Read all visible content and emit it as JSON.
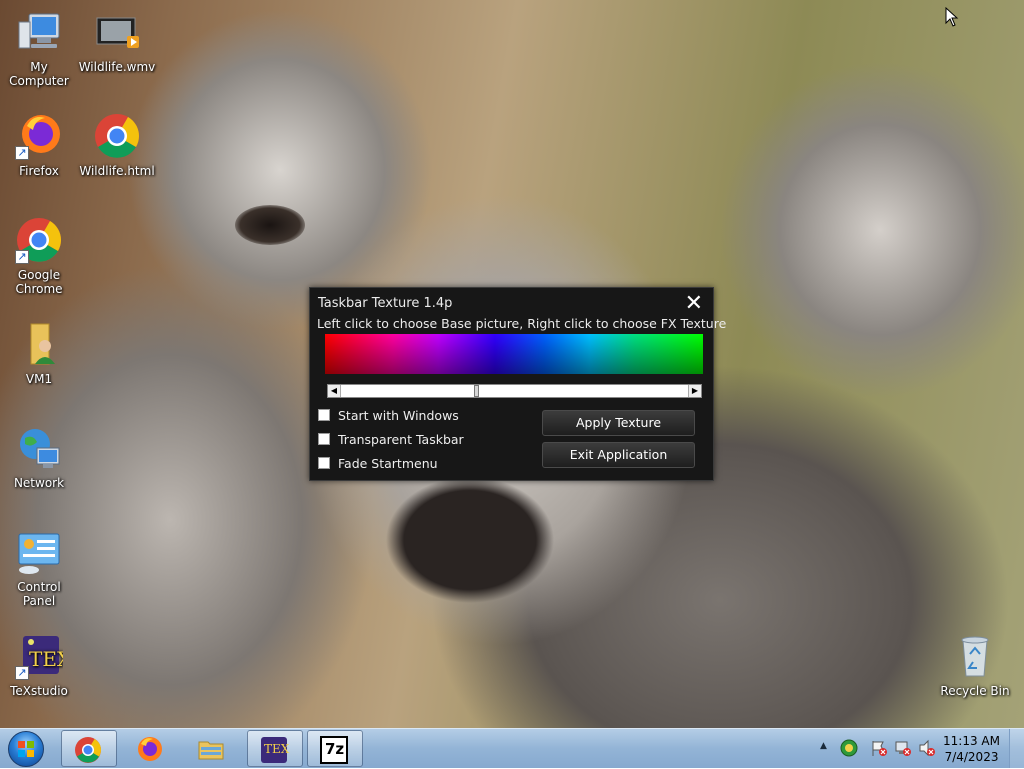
{
  "desktop": {
    "icons": [
      {
        "label": "My Computer",
        "icon": "computer-icon"
      },
      {
        "label": "Wildlife.wmv",
        "icon": "video-file-icon"
      },
      {
        "label": "Firefox",
        "icon": "firefox-icon"
      },
      {
        "label": "Wildlife.html",
        "icon": "chrome-icon"
      },
      {
        "label": "Google Chrome",
        "icon": "chrome-icon"
      },
      {
        "label": "VM1",
        "icon": "user-folder-icon"
      },
      {
        "label": "Network",
        "icon": "network-icon"
      },
      {
        "label": "Control Panel",
        "icon": "control-panel-icon"
      },
      {
        "label": "TeXstudio",
        "icon": "texstudio-icon"
      },
      {
        "label": "Recycle Bin",
        "icon": "recycle-bin-icon"
      }
    ]
  },
  "dialog": {
    "title": "Taskbar Texture 1.4p",
    "close_glyph": "✕",
    "instruction": "Left click to choose Base picture, Right click to choose FX Texture",
    "checkboxes": [
      {
        "label": "Start with Windows",
        "checked": false
      },
      {
        "label": "Transparent Taskbar",
        "checked": false
      },
      {
        "label": "Fade Startmenu",
        "checked": false
      }
    ],
    "apply_label": "Apply Texture",
    "exit_label": "Exit Application",
    "slider_left_glyph": "◀",
    "slider_right_glyph": "▶"
  },
  "taskbar": {
    "items": [
      {
        "name": "Google Chrome",
        "icon": "chrome-icon",
        "active": true
      },
      {
        "name": "Firefox",
        "icon": "firefox-icon",
        "active": false
      },
      {
        "name": "Windows Explorer",
        "icon": "folder-icon",
        "active": false
      },
      {
        "name": "TeXstudio",
        "icon": "texstudio-icon",
        "active": true
      },
      {
        "name": "7-Zip",
        "icon": "7zip-icon",
        "active": true
      }
    ],
    "texstudio_text": "TEX",
    "sevenzip_text": "7z",
    "clock": {
      "time": "11:13 AM",
      "date": "7/4/2023"
    },
    "tray_glyphs": {
      "chevron": "▲"
    }
  },
  "colors": {
    "dialog_bg": "#171717",
    "taskbar": "#93b4d6"
  }
}
